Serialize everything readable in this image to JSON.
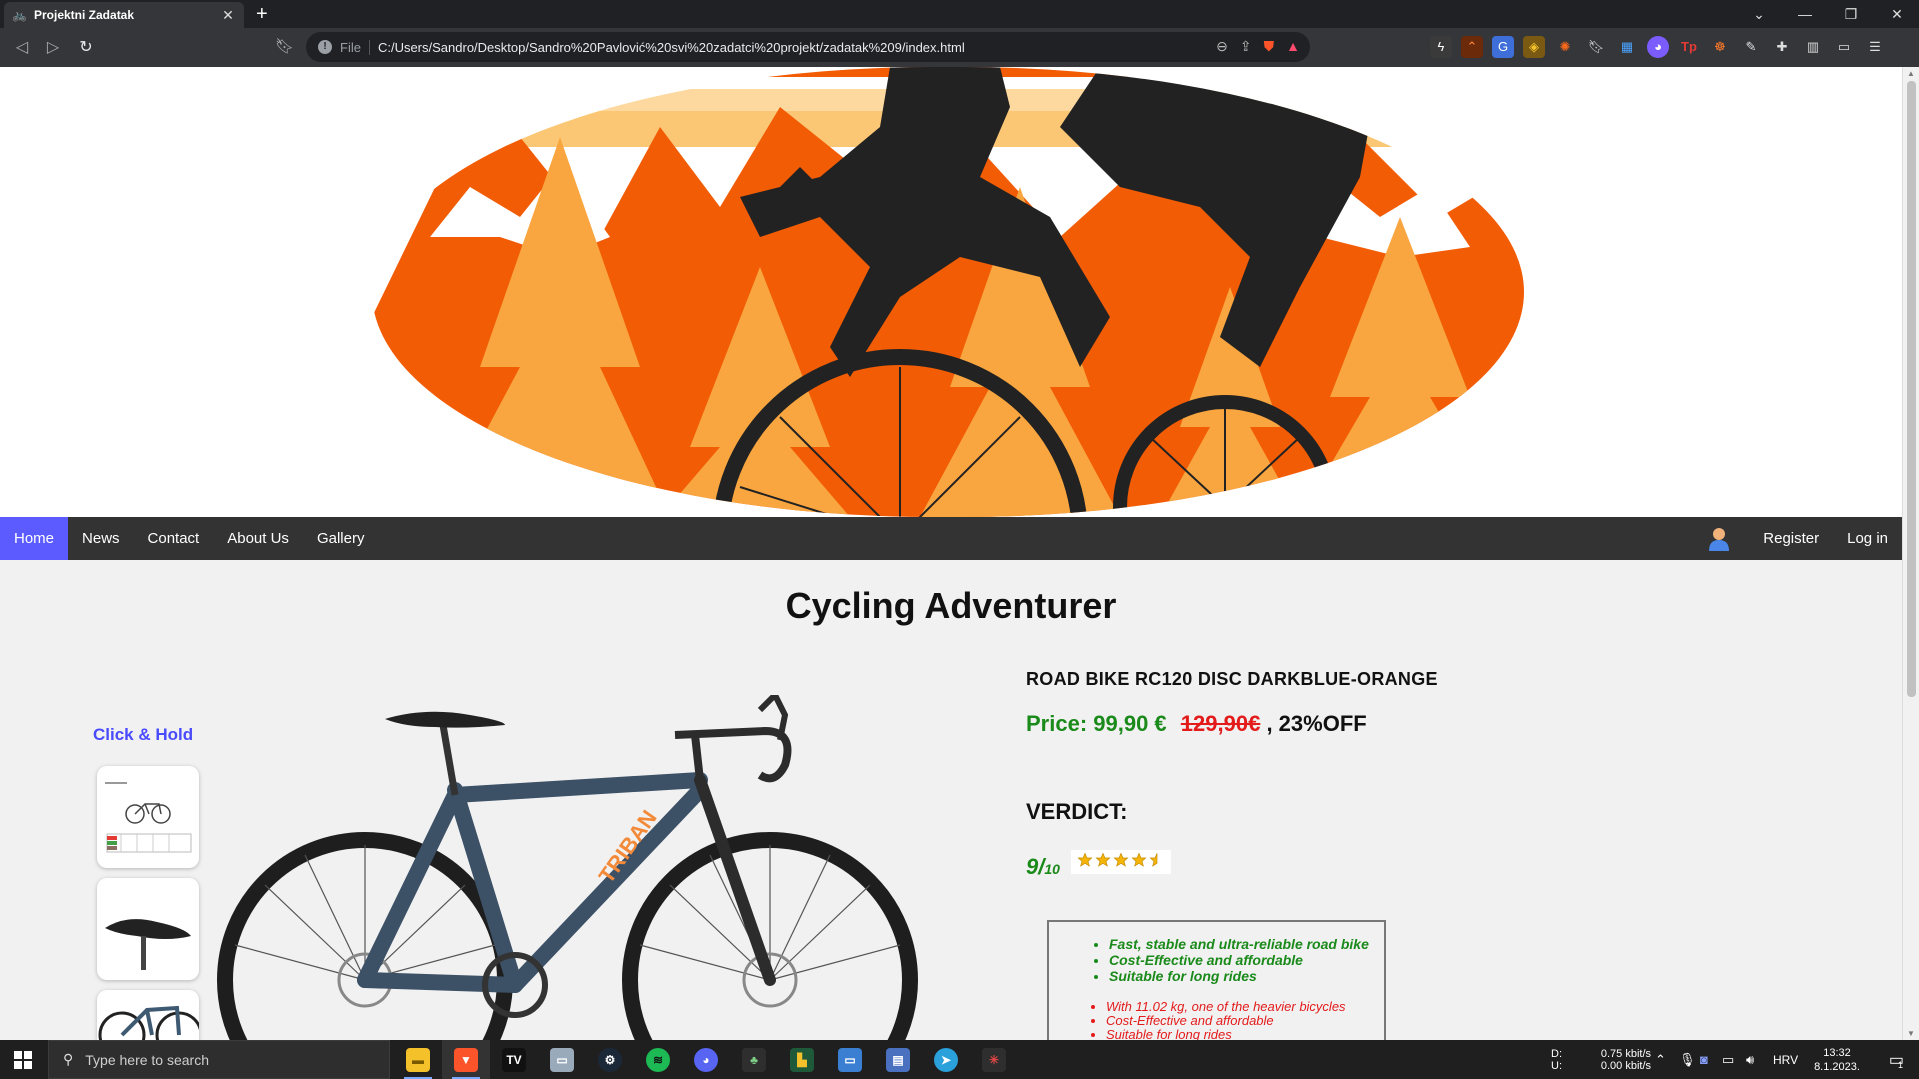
{
  "browser": {
    "tab_title": "Projektni Zadatak",
    "tab_close": "✕",
    "new_tab": "+",
    "file_label": "File",
    "url": "C:/Users/Sandro/Desktop/Sandro%20Pavlović%20svi%20zadatci%20projekt/zadatak%209/index.html"
  },
  "nav": {
    "items": [
      {
        "label": "Home",
        "active": true
      },
      {
        "label": "News"
      },
      {
        "label": "Contact"
      },
      {
        "label": "About Us"
      },
      {
        "label": "Gallery"
      }
    ],
    "register": "Register",
    "login": "Log in"
  },
  "page": {
    "title": "Cycling Adventurer",
    "click_hold": "Click & Hold",
    "product_name": "ROAD BIKE RC120 DISC DARKBLUE-ORANGE",
    "price_label": "Price: 99,90 €",
    "old_price": "129,90€",
    "discount": " , 23%OFF",
    "verdict": "VERDICT:",
    "score": "9/",
    "score_den": "10",
    "rating_stars": 4.5,
    "bike_brand_text": "TRIBAN",
    "pros": [
      "Fast, stable and ultra-reliable road bike",
      "Cost-Effective and affordable",
      "Suitable for long rides"
    ],
    "cons": [
      "With 11.02 kg, one of the heavier bicycles",
      "Cost-Effective and affordable",
      "Suitable for long rides"
    ]
  },
  "taskbar": {
    "search_placeholder": "Type here to search",
    "drive_d": "D:",
    "drive_u": "U:",
    "net_down": "0.75 kbit/s",
    "net_up": "0.00 kbit/s",
    "lang": "HRV",
    "time": "13:32",
    "date": "8.1.2023.",
    "notif_count": "1"
  },
  "colors": {
    "nav_active": "#5b5bff",
    "price_green": "#1a8a1a",
    "old_price_red": "#e41b1b",
    "hero_orange": "#f25c05",
    "hero_yellow": "#f9a640"
  }
}
